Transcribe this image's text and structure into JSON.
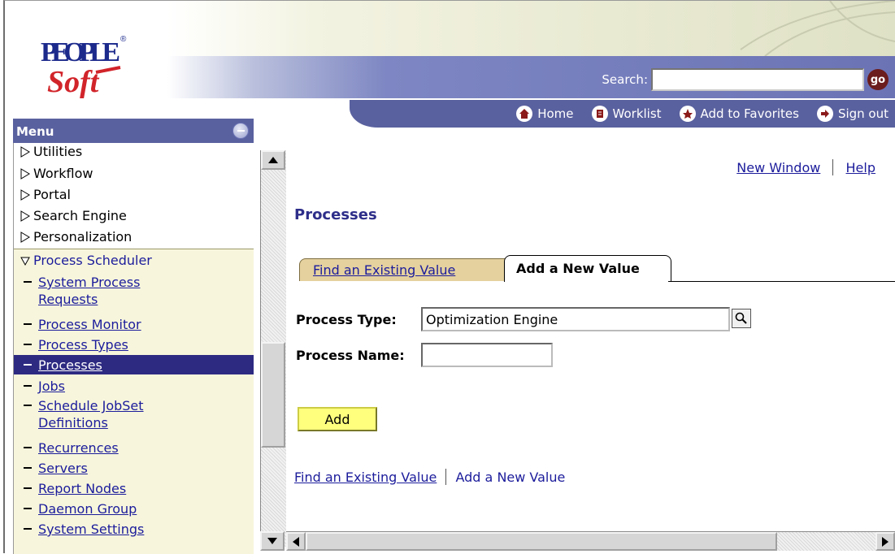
{
  "header": {
    "logo_alt": "PeopleSoft",
    "search_label": "Search:",
    "search_value": "",
    "go_label": "go",
    "nav": [
      {
        "label": "Home",
        "icon": "home-icon"
      },
      {
        "label": "Worklist",
        "icon": "worklist-icon"
      },
      {
        "label": "Add to Favorites",
        "icon": "favorites-icon"
      },
      {
        "label": "Sign out",
        "icon": "sign-out-icon"
      }
    ]
  },
  "menu": {
    "title": "Menu",
    "folders": [
      {
        "label": "Utilities"
      },
      {
        "label": "Workflow"
      },
      {
        "label": "Portal"
      },
      {
        "label": "Search Engine"
      },
      {
        "label": "Personalization"
      }
    ],
    "open_folder": "Process Scheduler",
    "items": [
      {
        "label": "System Process",
        "label2": "Requests"
      },
      {
        "label": "Process Monitor"
      },
      {
        "label": "Process Types"
      },
      {
        "label": "Processes",
        "selected": true
      },
      {
        "label": "Jobs"
      },
      {
        "label": "Schedule JobSet",
        "label2": "Definitions"
      },
      {
        "label": "Recurrences"
      },
      {
        "label": "Servers"
      },
      {
        "label": "Report Nodes"
      },
      {
        "label": "Daemon Group"
      },
      {
        "label": "System Settings"
      }
    ]
  },
  "content": {
    "new_window": "New Window",
    "help": "Help",
    "page_title": "Processes",
    "tabs": [
      {
        "label": "Find an Existing Value",
        "active": false
      },
      {
        "label": "Add a New Value",
        "active": true
      }
    ],
    "process_type_label": "Process Type:",
    "process_type_value": "Optimization Engine",
    "process_name_label": "Process Name:",
    "process_name_value": "",
    "add_button": "Add",
    "bottom_links": [
      "Find an Existing Value",
      "Add a New Value"
    ]
  },
  "colors": {
    "nav_bar": "#5a619f",
    "menu_selected": "#2d2a82",
    "link": "#1c1c9c",
    "add_button": "#ffff7d",
    "tab_inactive": "#e4d19e"
  }
}
